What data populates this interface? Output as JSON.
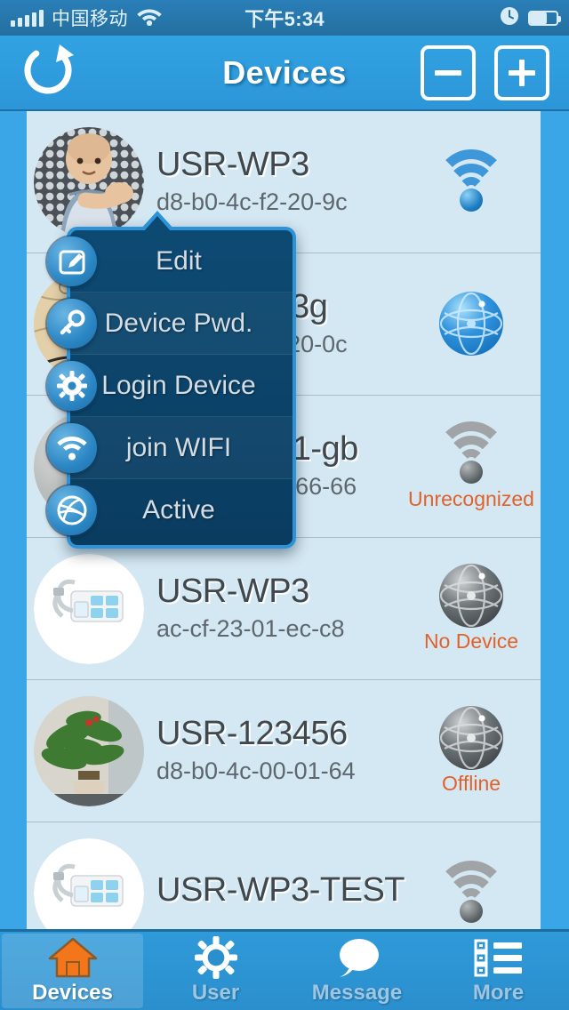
{
  "status_bar": {
    "carrier": "中国移动",
    "time": "下午5:34",
    "signal_icon": "signal-bars-icon",
    "wifi_icon": "wifi-icon",
    "alarm_icon": "clock-icon",
    "battery_icon": "battery-icon",
    "battery_level_pct": 62
  },
  "nav_bar": {
    "title": "Devices",
    "refresh_icon": "refresh-icon",
    "remove_icon": "minus-icon",
    "add_icon": "plus-icon"
  },
  "devices": [
    {
      "name": "USR-WP3",
      "mac": "d8-b0-4c-f2-20-9c",
      "status": "",
      "conn_icon": "wifi-signal-icon",
      "conn_state": "online",
      "avatar": "baby-photo"
    },
    {
      "name": "USR-WP3g",
      "mac": "d8-b0-4c-f2-20-0c",
      "status": "",
      "conn_icon": "globe-network-icon",
      "conn_state": "online",
      "avatar": "map-photo"
    },
    {
      "name": "USR-IOT1-gb",
      "mac": "66-66-66-66-66-66",
      "status": "Unrecognized",
      "conn_icon": "wifi-signal-icon",
      "conn_state": "offline",
      "avatar": "gray-photo"
    },
    {
      "name": "USR-WP3",
      "mac": "ac-cf-23-01-ec-c8",
      "status": "No Device",
      "conn_icon": "globe-network-icon",
      "conn_state": "offline",
      "avatar": "power-strip-photo"
    },
    {
      "name": "USR-123456",
      "mac": "d8-b0-4c-00-01-64",
      "status": "Offline",
      "conn_icon": "globe-network-icon",
      "conn_state": "offline",
      "avatar": "plant-photo"
    },
    {
      "name": "USR-WP3-TEST",
      "mac": "",
      "status": "",
      "conn_icon": "wifi-signal-icon",
      "conn_state": "offline",
      "avatar": "power-strip-photo"
    }
  ],
  "popup_menu": {
    "items": [
      {
        "label": "Edit",
        "icon": "edit-pencil-icon"
      },
      {
        "label": "Device Pwd.",
        "icon": "key-icon"
      },
      {
        "label": "Login Device",
        "icon": "gear-icon"
      },
      {
        "label": "join WIFI",
        "icon": "wifi-icon"
      },
      {
        "label": "Active",
        "icon": "ball-icon"
      }
    ]
  },
  "tab_bar": {
    "items": [
      {
        "label": "Devices",
        "icon": "home-icon",
        "active": true
      },
      {
        "label": "User",
        "icon": "gear-icon",
        "active": false
      },
      {
        "label": "Message",
        "icon": "chat-bubble-icon",
        "active": false
      },
      {
        "label": "More",
        "icon": "list-icon",
        "active": false
      }
    ]
  },
  "colors": {
    "accent": "#2c93d8",
    "status_text": "#e0622a",
    "active_tab_icon": "#f4761b",
    "list_bg": "#d4e8f3"
  }
}
